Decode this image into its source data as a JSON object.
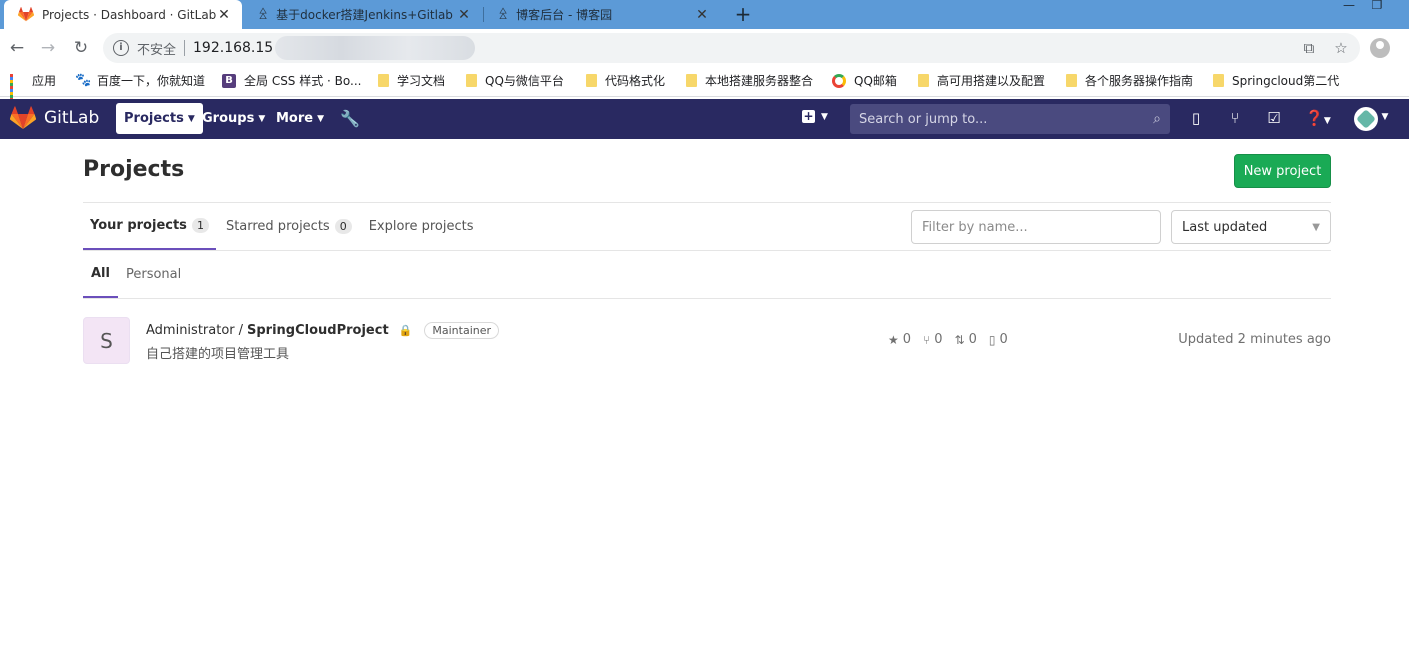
{
  "browser": {
    "tabs": [
      {
        "title": "Projects · Dashboard · GitLab",
        "active": true,
        "icon": "gitlab-icon"
      },
      {
        "title": "基于docker搭建Jenkins+Gitlab",
        "active": false,
        "icon": "cnblogs-icon"
      },
      {
        "title": "博客后台 - 博客园",
        "active": false,
        "icon": "cnblogs-icon"
      }
    ],
    "new_tab": "+",
    "address": {
      "security_label": "不安全",
      "url_visible": "192.168.15"
    },
    "bookmarks": [
      {
        "label": "应用",
        "icon": "apps-icon"
      },
      {
        "label": "百度一下，你就知道",
        "icon": "baidu-icon"
      },
      {
        "label": "全局 CSS 样式 · Bo...",
        "icon": "bootstrap-icon"
      },
      {
        "label": "学习文档",
        "icon": "folder-icon"
      },
      {
        "label": "QQ与微信平台",
        "icon": "folder-icon"
      },
      {
        "label": "代码格式化",
        "icon": "folder-icon"
      },
      {
        "label": "本地搭建服务器整合",
        "icon": "folder-icon"
      },
      {
        "label": "QQ邮箱",
        "icon": "qqmail-icon"
      },
      {
        "label": "高可用搭建以及配置",
        "icon": "folder-icon"
      },
      {
        "label": "各个服务器操作指南",
        "icon": "folder-icon"
      },
      {
        "label": "Springcloud第二代",
        "icon": "folder-icon"
      }
    ]
  },
  "gitlab": {
    "brand": "GitLab",
    "nav": {
      "projects": "Projects",
      "groups": "Groups",
      "more": "More"
    },
    "search_placeholder": "Search or jump to...",
    "colors": {
      "header": "#292961",
      "accent": "#6b4fbb",
      "success": "#1aaa55"
    }
  },
  "page": {
    "title": "Projects",
    "new_project": "New project",
    "tabs": [
      {
        "label": "Your projects",
        "count": "1",
        "active": true
      },
      {
        "label": "Starred projects",
        "count": "0",
        "active": false
      },
      {
        "label": "Explore projects",
        "count": null,
        "active": false
      }
    ],
    "filter_placeholder": "Filter by name...",
    "sort_selected": "Last updated",
    "subtabs": [
      {
        "label": "All",
        "active": true
      },
      {
        "label": "Personal",
        "active": false
      }
    ],
    "projects": [
      {
        "avatar_letter": "S",
        "namespace": "Administrator",
        "separator": "/",
        "name": "SpringCloudProject",
        "role": "Maintainer",
        "description": "自己搭建的项目管理工具",
        "stars": "0",
        "forks": "0",
        "merge_requests": "0",
        "issues": "0",
        "updated": "Updated 2 minutes ago"
      }
    ]
  }
}
